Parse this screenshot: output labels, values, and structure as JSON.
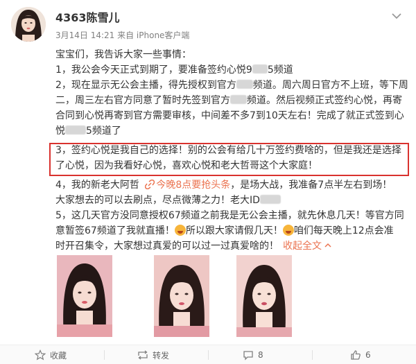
{
  "post": {
    "username": "4363陈雪儿",
    "meta": "3月14日 14:21 来自 iPhone客户端",
    "lines": {
      "l1": "宝宝们，我告诉大家一些事情：",
      "l2a": "1，我公会今天正式到期了，要准备签约心悦9",
      "l2b": "5频道",
      "l3a": "2，现在显示无公会主播，得先授权到官方",
      "l3b": "频道。周六周日官方不上班，等下周",
      "l4a": "二，周三左右官方同意了暂时先签到官方",
      "l4b": "频道。然后视频正式签约心悦，再寄",
      "l5": "合同到心悦再寄到官方需要审核，中间差不多7到10天左右！完成了就正式签到心",
      "l6a": "悦",
      "l6b": "5频道了",
      "l7": "3，签约心悦是我自己的选择！别的公会有给几十万签约费啥的，但是我还是选择",
      "l8": "了心悦，因为我看好心悦，喜欢心悦和老大哲哥这个大家庭！",
      "l9a": "4，我的新老大阿哲",
      "l9link": "今晚8点要抢头条",
      "l9b": "，是场大战，我准备7点半左右到场！",
      "l10a": "大家想去的可以去刷点，尽点微薄之力！老大ID",
      "l11": "5，这几天官方没同意授权67频道之前我是无公会主播，就先休息几天！等官方同",
      "l12a": "意暂签67频道了我就直播！",
      "l12b": "所以跟大家请假几天！",
      "l12c": "咱们每天晚上12点会准",
      "l13a": "时开召集令，大家想过真爱的可以过一过真爱啥的！",
      "l13link": "收起全文"
    }
  },
  "actions": {
    "favorite": "收藏",
    "repost": "转发",
    "comment": "8",
    "like": "6"
  },
  "colors": {
    "highlight_border": "#d9322e",
    "link": "#eb7350"
  },
  "icons": [
    "chevron-down-icon",
    "star-icon",
    "repost-icon",
    "comment-icon",
    "thumbs-up-icon",
    "emoji-icon"
  ]
}
